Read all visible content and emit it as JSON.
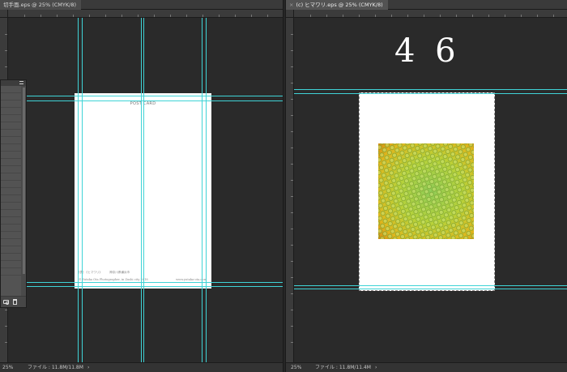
{
  "left_window": {
    "tab_title": "切手面.eps @ 25% (CMYK/8)",
    "zoom": "25%",
    "file_info": "ファイル : 11.8M/11.8M",
    "status_arrow": "›",
    "document": {
      "heading": "POST CARD",
      "caption": "[表] 《ヒマワリ》　　　神奈川県横浜市",
      "copyright": "© Yutaka Ota Photographer, in Zushi city 2018",
      "url": "www.yutaka-ota.com"
    }
  },
  "right_window": {
    "tab_title": "(c) ヒマワリ.eps @ 25% (CMYK/8)",
    "close_glyph": "×",
    "zoom": "25%",
    "file_info": "ファイル : 11.8M/11.4M",
    "status_arrow": "›",
    "page_label": "4 6"
  },
  "side_panel": {
    "menu_icon": "panel-menu-icon",
    "footer_icons": [
      "camera-icon",
      "trash-icon"
    ]
  },
  "colors": {
    "guide": "#3fd3d6",
    "canvas": "#2a2a2a"
  }
}
